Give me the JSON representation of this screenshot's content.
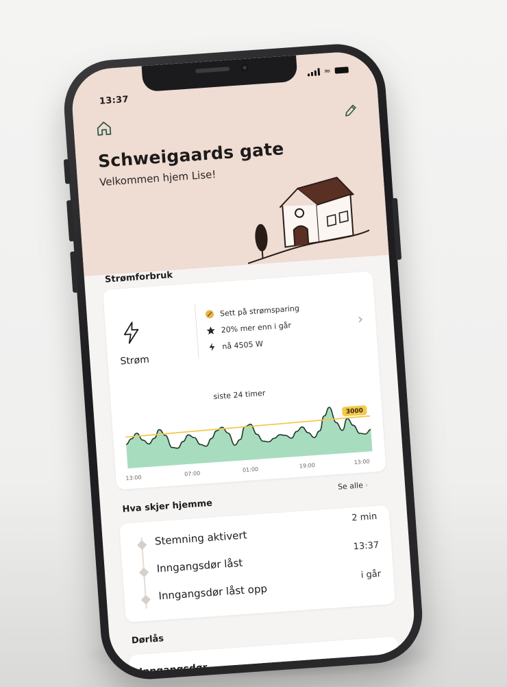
{
  "status_bar": {
    "time": "13:37"
  },
  "header": {
    "title": "Schweigaards gate",
    "subtitle": "Velkommen hjem Lise!",
    "home_icon": "home-icon",
    "edit_icon": "pencil-icon"
  },
  "power": {
    "section_title": "Strømforbruk",
    "label": "Strøm",
    "icon": "lightning-icon",
    "facts": [
      {
        "icon": "leaf-icon",
        "text": "Sett på strømsparing"
      },
      {
        "icon": "star-icon",
        "text": "20% mer enn i går"
      },
      {
        "icon": "bolt-icon",
        "text": "nå 4505 W"
      }
    ],
    "chart_caption": "siste 24 timer"
  },
  "chart_data": {
    "type": "area",
    "title": "siste 24 timer",
    "x_ticks": [
      "13:00",
      "07:00",
      "01:00",
      "19:00",
      "13:00"
    ],
    "threshold": {
      "value": 3000,
      "label": "3000"
    },
    "series": [
      {
        "values": [
          2300,
          2800,
          3300,
          2600,
          2200,
          2700,
          3500,
          2900,
          1700,
          1600,
          2200,
          2800,
          2500,
          1800,
          1600,
          2300,
          3000,
          3300,
          2700,
          1500,
          2000,
          3200,
          3400,
          2400,
          1700,
          1600,
          1900,
          2200,
          2100,
          1800,
          2400,
          2800,
          2200,
          1700,
          2300,
          3700,
          4500,
          3000,
          2200,
          3300,
          2600,
          1800,
          1700,
          2100
        ]
      }
    ],
    "ylim": [
      0,
      5000
    ],
    "colors": {
      "fill": "#a8dcbe",
      "line": "#1f3a2c",
      "threshold": "#f2c94c"
    }
  },
  "events": {
    "section_title": "Hva skjer hjemme",
    "see_all": "Se alle",
    "items": [
      {
        "label": "Stemning aktivert",
        "time": "2 min"
      },
      {
        "label": "Inngangsdør låst",
        "time": "13:37"
      },
      {
        "label": "Inngangsdør låst opp",
        "time": "i går"
      }
    ]
  },
  "lock": {
    "section_title": "Dørlås",
    "door_name": "Inngangsdør"
  }
}
